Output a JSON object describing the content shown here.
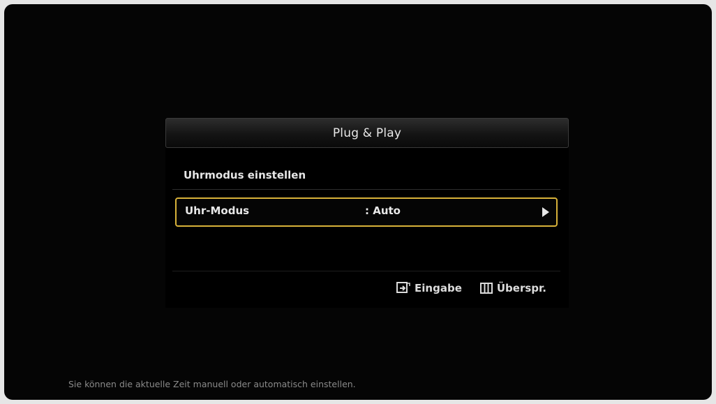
{
  "dialog": {
    "title": "Plug & Play",
    "subtitle": "Uhrmodus einstellen",
    "option": {
      "label": "Uhr-Modus",
      "value": ": Auto"
    }
  },
  "actions": {
    "enter_label": "Eingabe",
    "skip_label": "Überspr."
  },
  "hint_text": "Sie können die aktuelle Zeit manuell oder automatisch einstellen.",
  "icons": {
    "enter": "enter-icon",
    "skip": "skip-icon",
    "arrow": "arrow-right-icon"
  },
  "colors": {
    "highlight": "#d8b23a",
    "background": "#050505",
    "text": "#e8e8e8",
    "hint": "#8a8a8a"
  }
}
